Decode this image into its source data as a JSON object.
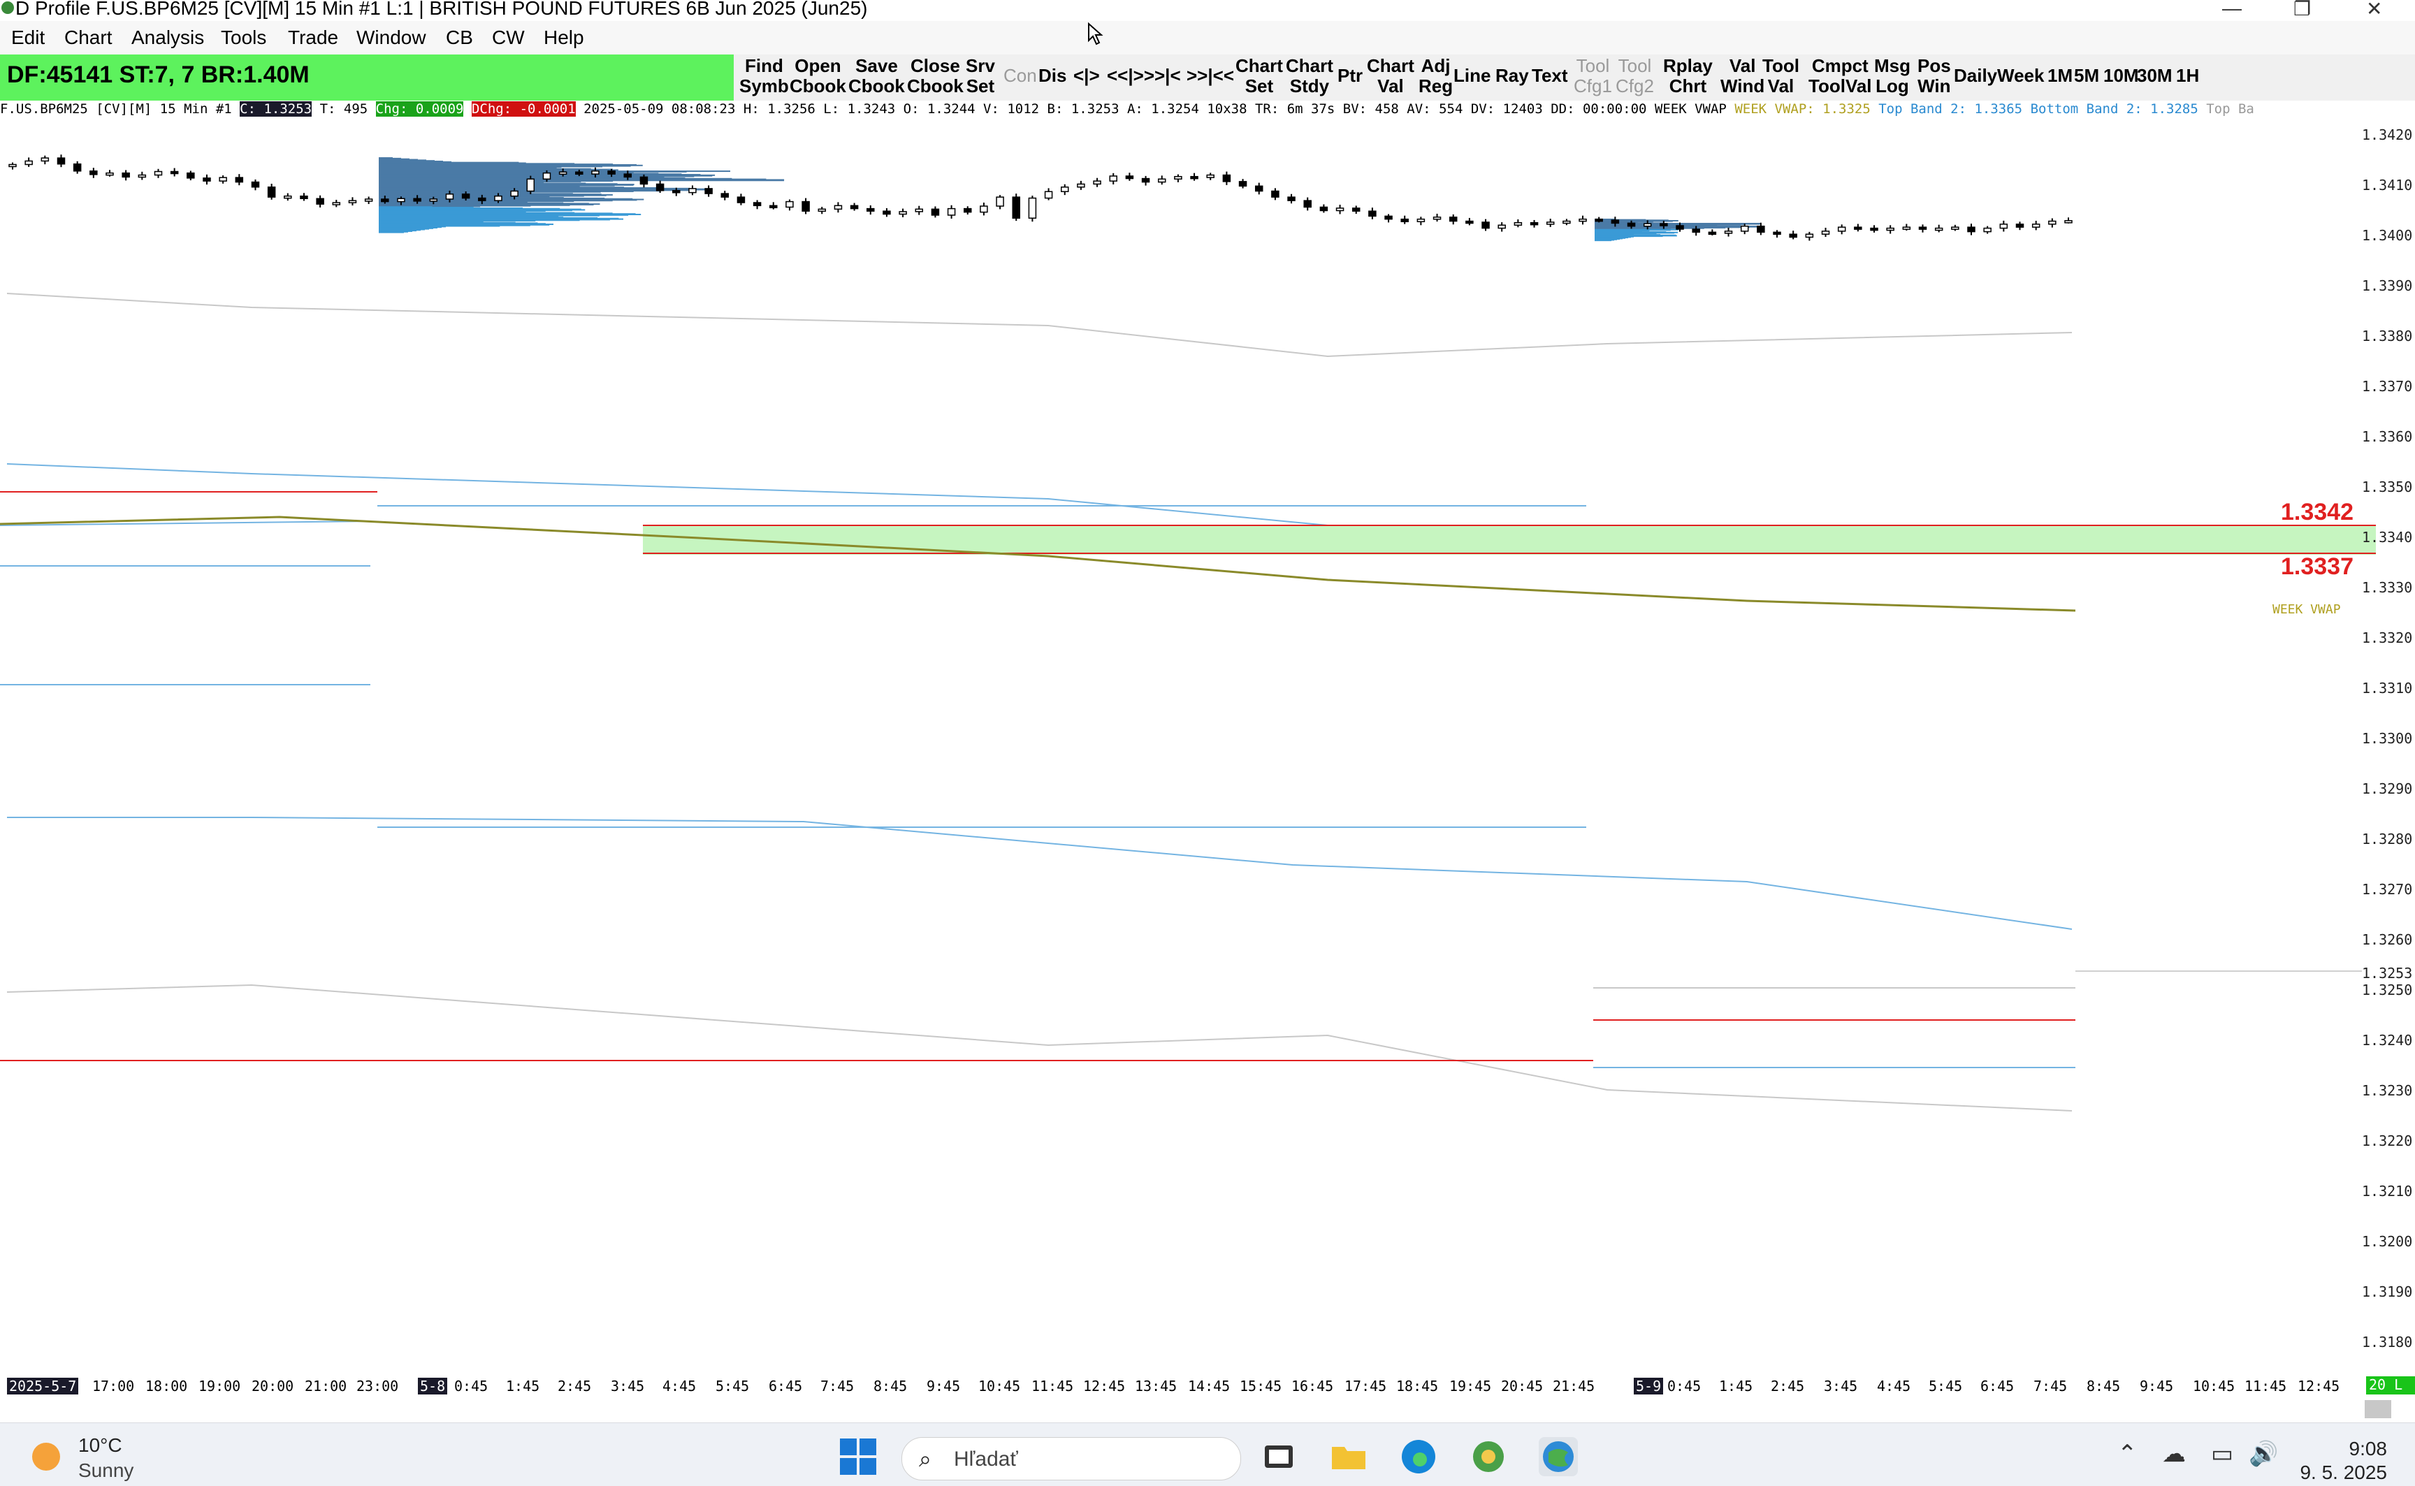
{
  "window": {
    "title": "D Profile F.US.BP6M25 [CV][M]  15 Min  #1 L:1 | BRITISH POUND FUTURES 6B Jun 2025 (Jun25)",
    "minimize": "—",
    "restore": "❐",
    "close": "✕"
  },
  "menu": [
    "Edit",
    "Chart",
    "Analysis",
    "Tools",
    "Trade",
    "Window",
    "CB",
    "CW",
    "Help"
  ],
  "status": "DF:45141  ST:7, 7  BR:1.40M",
  "toolbar": [
    {
      "l1": "Find",
      "l2": "Symb",
      "dis": false
    },
    {
      "l1": "Open",
      "l2": "Cbook",
      "dis": false
    },
    {
      "l1": "Save",
      "l2": "Cbook",
      "dis": false
    },
    {
      "l1": "Close",
      "l2": "Cbook",
      "dis": false
    },
    {
      "l1": "Srv",
      "l2": "Set",
      "dis": false
    },
    {
      "l1": "Con",
      "l2": "",
      "dis": true
    },
    {
      "l1": "Dis",
      "l2": "",
      "dis": false
    },
    {
      "l1": "<|>",
      "l2": "",
      "dis": false
    },
    {
      "l1": "<<|>>",
      "l2": "",
      "dis": false
    },
    {
      "l1": ">|<",
      "l2": "",
      "dis": false
    },
    {
      "l1": ">>|<<",
      "l2": "",
      "dis": false
    },
    {
      "l1": "Chart",
      "l2": "Set",
      "dis": false
    },
    {
      "l1": "Chart",
      "l2": "Stdy",
      "dis": false
    },
    {
      "l1": "Ptr",
      "l2": "",
      "dis": false
    },
    {
      "l1": "Chart",
      "l2": "Val",
      "dis": false
    },
    {
      "l1": "Adj",
      "l2": "Reg",
      "dis": false
    },
    {
      "l1": "Line",
      "l2": "",
      "dis": false
    },
    {
      "l1": "Ray",
      "l2": "",
      "dis": false
    },
    {
      "l1": "Text",
      "l2": "",
      "dis": false
    },
    {
      "l1": "Tool",
      "l2": "Cfg1",
      "dis": true
    },
    {
      "l1": "Tool",
      "l2": "Cfg2",
      "dis": true
    },
    {
      "l1": "Rplay",
      "l2": "Chrt",
      "dis": false
    },
    {
      "l1": "Val",
      "l2": "Wind",
      "dis": false
    },
    {
      "l1": "Tool",
      "l2": "Val",
      "dis": false
    },
    {
      "l1": "Cmpct",
      "l2": "ToolVal",
      "dis": false
    },
    {
      "l1": "Msg",
      "l2": "Log",
      "dis": false
    },
    {
      "l1": "Pos",
      "l2": "Win",
      "dis": false
    },
    {
      "l1": "Daily",
      "l2": "",
      "dis": false
    },
    {
      "l1": "Week",
      "l2": "",
      "dis": false
    },
    {
      "l1": "1M",
      "l2": "",
      "dis": false
    },
    {
      "l1": "5M",
      "l2": "",
      "dis": false
    },
    {
      "l1": "10M",
      "l2": "",
      "dis": false
    },
    {
      "l1": "30M",
      "l2": "",
      "dis": false
    },
    {
      "l1": "1H",
      "l2": "",
      "dis": false
    }
  ],
  "infoline": {
    "symbol": "F.US.BP6M25 [CV][M]  15 Min  #1 ",
    "close": "C: 1.3253",
    "trades": " T: 495 ",
    "chg": "Chg: 0.0009",
    "dchg": "DChg: -0.0001",
    "rest": " 2025-05-09 08:08:23 H: 1.3256  L: 1.3243  O: 1.3244  V: 1012  B: 1.3253  A: 1.3254  10x38  TR: 6m 37s  BV: 458  AV: 554  DV: 12403  DD: 00:00:00  WEEK VWAP ",
    "vwap": "WEEK VWAP: 1.3325 ",
    "topband": " Top Band 2: 1.3365 ",
    "bottomband": " Bottom Band 2: 1.3285 ",
    "topba": " Top Ba"
  },
  "price_labels": [
    "1.3420",
    "1.3410",
    "1.3400",
    "1.3390",
    "1.3380",
    "1.3370",
    "1.3360",
    "1.3350",
    "1.3340",
    "1.3330",
    "1.3320",
    "1.3310",
    "1.3300",
    "1.3290",
    "1.3280",
    "1.3270",
    "1.3260",
    "1.3253",
    "1.3250",
    "1.3240",
    "1.3230",
    "1.3220",
    "1.3210",
    "1.3200",
    "1.3190",
    "1.3180"
  ],
  "zone_high": "1.3342",
  "zone_low": "1.3337",
  "vwap_label": "WEEK VWAP",
  "last_price": "20 L",
  "time_labels": [
    "2025-5-7",
    "17:00",
    "18:00",
    "19:00",
    "20:00",
    "21:00",
    "23:00",
    "5-8",
    "0:45",
    "1:45",
    "2:45",
    "3:45",
    "4:45",
    "5:45",
    "6:45",
    "7:45",
    "8:45",
    "9:45",
    "10:45",
    "11:45",
    "12:45",
    "13:45",
    "14:45",
    "15:45",
    "16:45",
    "17:45",
    "18:45",
    "19:45",
    "20:45",
    "21:45",
    "5-9",
    "0:45",
    "1:45",
    "2:45",
    "3:45",
    "4:45",
    "5:45",
    "6:45",
    "7:45",
    "8:45",
    "9:45",
    "10:45",
    "11:45",
    "12:45"
  ],
  "taskbar": {
    "temp": "10°C",
    "condition": "Sunny",
    "search": "Hľadať",
    "time": "9:08",
    "date": "9. 5. 2025"
  },
  "colors": {
    "status_green": "#5df25d",
    "bull": "#ffffff",
    "bear": "#000000",
    "profile_dark": "#4a7aa6",
    "profile_light": "#3a9ad6",
    "zone": "#c6f5c0",
    "red": "#e02020",
    "vwap": "#8a8a2a",
    "band": "#74b4e2"
  }
}
